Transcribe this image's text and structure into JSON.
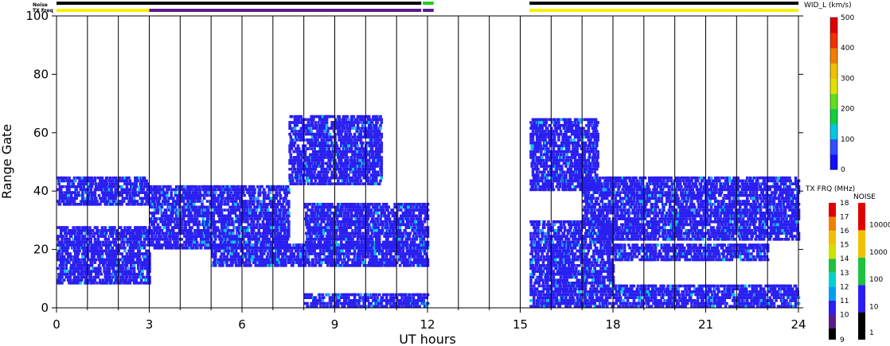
{
  "status_strips": {
    "noise_label": "Noise",
    "txfreq_label": "TX Freq"
  },
  "chart_data": {
    "type": "heatmap",
    "title": "",
    "xlabel": "UT hours",
    "ylabel": "Range Gate",
    "xlim": [
      0,
      24
    ],
    "ylim": [
      0,
      100
    ],
    "x_ticks": [
      0,
      3,
      6,
      9,
      12,
      15,
      18,
      21,
      24
    ],
    "y_ticks": [
      0,
      20,
      40,
      60,
      80,
      100
    ],
    "data_gap": [
      12,
      15
    ],
    "value_quantity": "WID_L (km/s)",
    "colorbar": {
      "label": "WID_L (km/s)",
      "range": [
        0,
        500
      ],
      "ticks": [
        0,
        100,
        200,
        300,
        400,
        500
      ]
    },
    "txfreq_legend": {
      "label": "TX FRQ (MHz)",
      "ticks": [
        9,
        10,
        11,
        12,
        13,
        14,
        15,
        16,
        17,
        18
      ]
    },
    "noise_legend": {
      "label": "NOISE",
      "ticks": [
        "1",
        "10",
        "100",
        "1000",
        "10000"
      ]
    },
    "echo_bands": [
      {
        "from_ut": 0.0,
        "to_ut": 3.0,
        "gates": [
          35,
          45
        ]
      },
      {
        "from_ut": 0.0,
        "to_ut": 3.0,
        "gates": [
          8,
          28
        ]
      },
      {
        "from_ut": 3.0,
        "to_ut": 7.5,
        "gates": [
          20,
          42
        ]
      },
      {
        "from_ut": 7.5,
        "to_ut": 10.5,
        "gates": [
          42,
          66
        ]
      },
      {
        "from_ut": 5.0,
        "to_ut": 12.0,
        "gates": [
          14,
          22
        ]
      },
      {
        "from_ut": 8.0,
        "to_ut": 12.0,
        "gates": [
          20,
          36
        ]
      },
      {
        "from_ut": 8.0,
        "to_ut": 12.0,
        "gates": [
          0,
          5
        ]
      },
      {
        "from_ut": 15.3,
        "to_ut": 17.5,
        "gates": [
          40,
          65
        ]
      },
      {
        "from_ut": 17.0,
        "to_ut": 24.0,
        "gates": [
          30,
          45
        ]
      },
      {
        "from_ut": 17.5,
        "to_ut": 24.0,
        "gates": [
          23,
          30
        ]
      },
      {
        "from_ut": 15.3,
        "to_ut": 18.0,
        "gates": [
          8,
          30
        ]
      },
      {
        "from_ut": 18.0,
        "to_ut": 23.0,
        "gates": [
          16,
          22
        ]
      },
      {
        "from_ut": 15.3,
        "to_ut": 24.0,
        "gates": [
          0,
          8
        ]
      }
    ],
    "grid": {
      "hourly_vertical_lines": true,
      "horizontal": false
    },
    "colors": {
      "echo_blue": "#2a1ff0",
      "txfreq_strip": "#f5f000",
      "txfreq_strip_alt": "#5a1a8c",
      "noise_strip": "#000000",
      "noise_strip_alt": "#22cc22"
    }
  }
}
